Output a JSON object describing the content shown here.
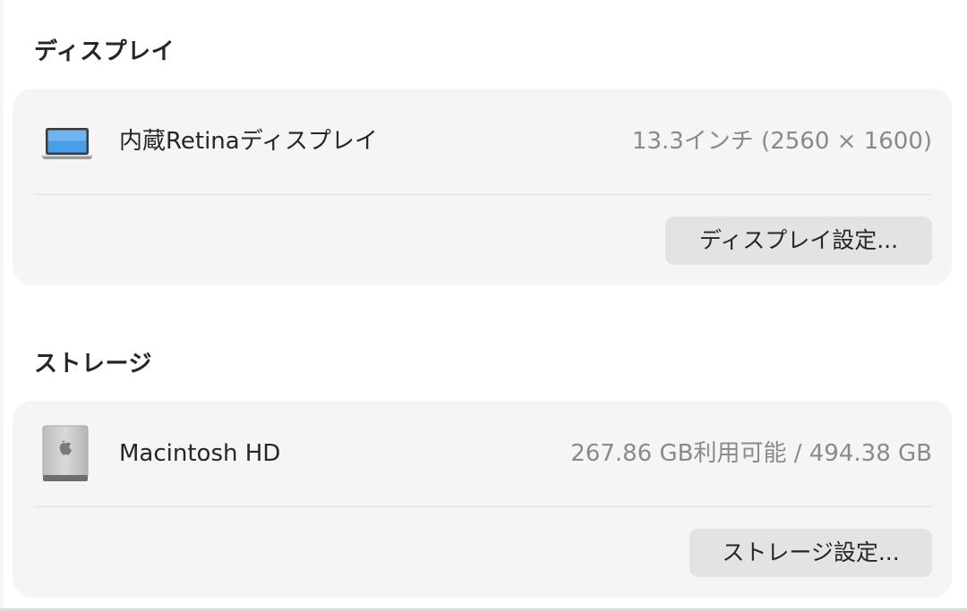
{
  "display_section": {
    "title": "ディスプレイ",
    "item": {
      "icon": "laptop-icon",
      "label": "内蔵Retinaディスプレイ",
      "value": "13.3インチ (2560 × 1600)"
    },
    "button_label": "ディスプレイ設定..."
  },
  "storage_section": {
    "title": "ストレージ",
    "item": {
      "icon": "hard-drive-icon",
      "label": "Macintosh HD",
      "value": "267.86 GB利用可能 / 494.38 GB"
    },
    "button_label": "ストレージ設定..."
  }
}
